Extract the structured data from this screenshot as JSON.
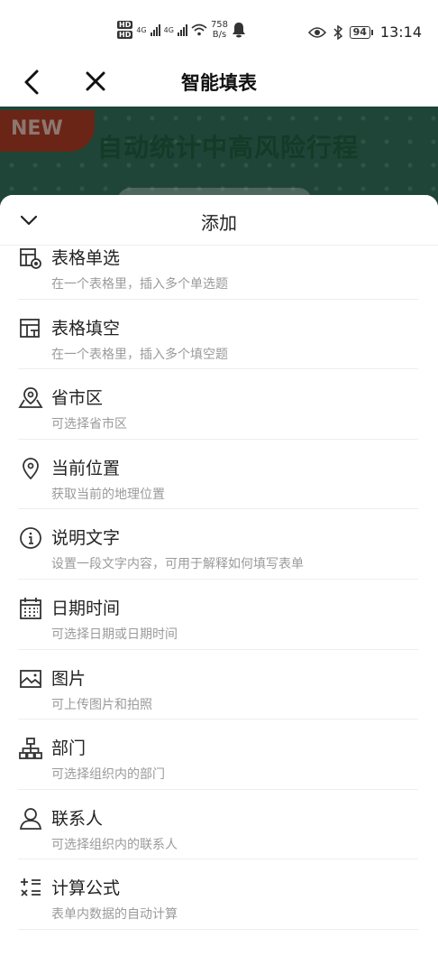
{
  "status_bar": {
    "network_1": "4G",
    "network_2": "4G",
    "speed_value": "758",
    "speed_unit": "B/s",
    "battery": "94",
    "time": "13:14"
  },
  "nav": {
    "title": "智能填表"
  },
  "banner": {
    "badge": "NEW",
    "title": "自动统计中高风险行程"
  },
  "sheet": {
    "title": "添加",
    "items": [
      {
        "label": "表格单选",
        "desc": "在一个表格里，插入多个单选题",
        "icon": "table-radio-icon"
      },
      {
        "label": "表格填空",
        "desc": "在一个表格里，插入多个填空题",
        "icon": "table-fill-icon"
      },
      {
        "label": "省市区",
        "desc": "可选择省市区",
        "icon": "map-region-icon"
      },
      {
        "label": "当前位置",
        "desc": "获取当前的地理位置",
        "icon": "location-pin-icon"
      },
      {
        "label": "说明文字",
        "desc": "设置一段文字内容，可用于解释如何填写表单",
        "icon": "info-icon"
      },
      {
        "label": "日期时间",
        "desc": "可选择日期或日期时间",
        "icon": "calendar-icon"
      },
      {
        "label": "图片",
        "desc": "可上传图片和拍照",
        "icon": "image-icon"
      },
      {
        "label": "部门",
        "desc": "可选择组织内的部门",
        "icon": "org-tree-icon"
      },
      {
        "label": "联系人",
        "desc": "可选择组织内的联系人",
        "icon": "contact-icon"
      },
      {
        "label": "计算公式",
        "desc": "表单内数据的自动计算",
        "icon": "formula-icon"
      }
    ]
  }
}
